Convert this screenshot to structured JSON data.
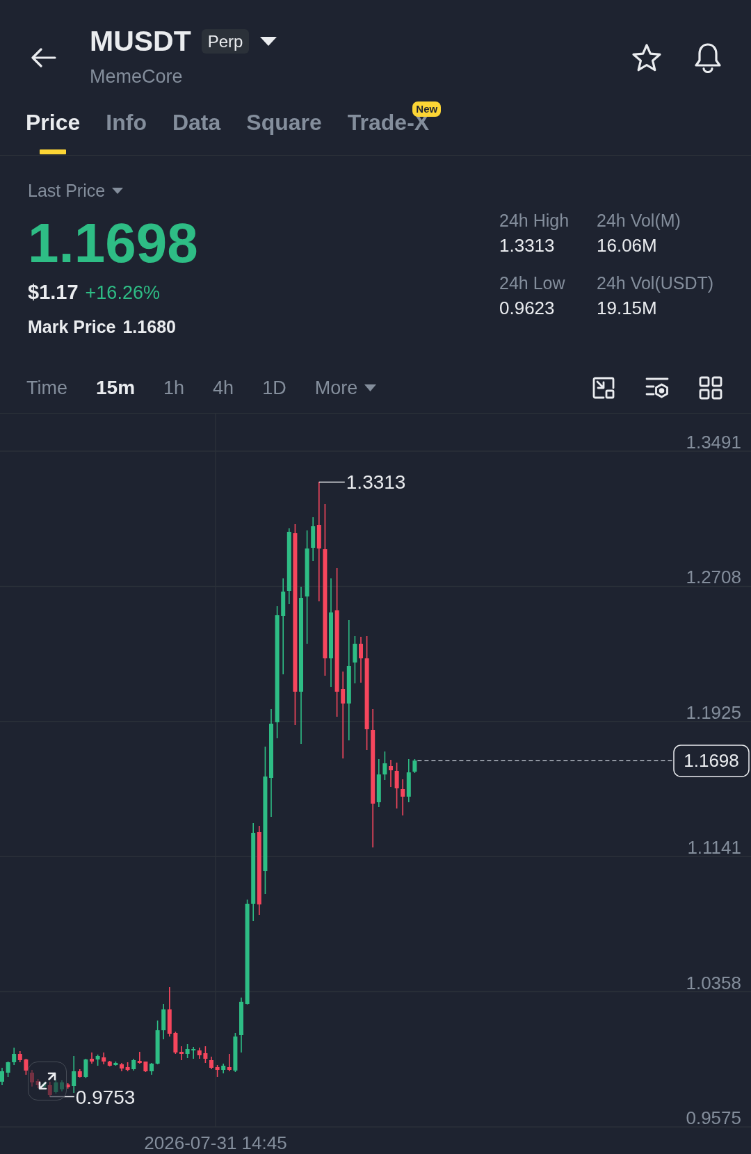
{
  "header": {
    "symbol": "MUSDT",
    "contract_type": "Perp",
    "name": "MemeCore"
  },
  "tabs": [
    {
      "label": "Price",
      "selected": true
    },
    {
      "label": "Info",
      "selected": false
    },
    {
      "label": "Data",
      "selected": false
    },
    {
      "label": "Square",
      "selected": false
    },
    {
      "label": "Trade-X",
      "selected": false,
      "badge": "New"
    }
  ],
  "price": {
    "selector_label": "Last Price",
    "last_price": "1.1698",
    "rising": true,
    "usd_price": "$1.17",
    "change": "+16.26%",
    "mark_label": "Mark Price",
    "mark_price": "1.1680"
  },
  "stats": [
    {
      "label": "24h High",
      "value": "1.3313"
    },
    {
      "label": "24h Vol(M)",
      "value": "16.06M"
    },
    {
      "label": "24h Low",
      "value": "0.9623"
    },
    {
      "label": "24h Vol(USDT)",
      "value": "19.15M"
    }
  ],
  "intervals": [
    {
      "label": "Time",
      "selected": false
    },
    {
      "label": "15m",
      "selected": true
    },
    {
      "label": "1h",
      "selected": false
    },
    {
      "label": "4h",
      "selected": false
    },
    {
      "label": "1D",
      "selected": false
    }
  ],
  "more_menu": {
    "label": "More"
  },
  "chart": {
    "price_axis": [
      "1.3491",
      "1.2708",
      "1.1925",
      "1.1141",
      "1.0358",
      "0.9575"
    ],
    "high_marker": "1.3313",
    "low_marker": "0.9753",
    "current_price": "1.1698",
    "time_label": "2026-07-31 14:45"
  }
}
